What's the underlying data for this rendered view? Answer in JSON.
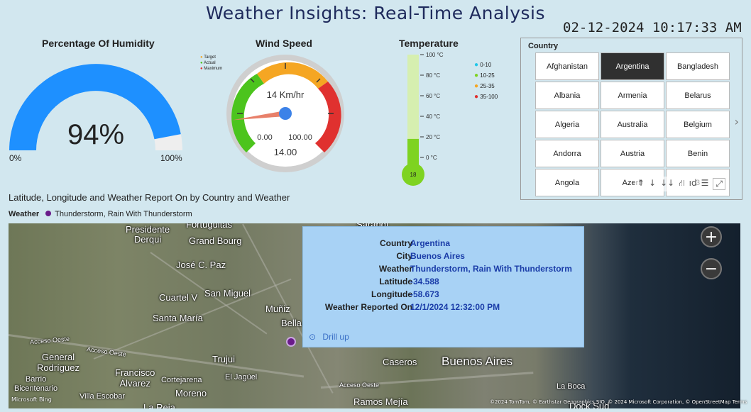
{
  "header": {
    "title": "Weather Insights: Real-Time Analysis",
    "datetime": "02-12-2024 10:17:33 AM"
  },
  "humidity": {
    "title": "Percentage Of Humidity",
    "value_label": "94%",
    "value": 94,
    "min_label": "0%",
    "max_label": "100%",
    "color": "#1e90ff"
  },
  "wind": {
    "title": "Wind Speed",
    "center_label": "14 Km/hr",
    "min_label": "0.00",
    "max_label": "100.00",
    "value_label": "14.00",
    "value": 14,
    "legend": [
      {
        "label": "Target",
        "color": "#f5a623"
      },
      {
        "label": "Actual",
        "color": "#4cc41d"
      },
      {
        "label": "Maximum",
        "color": "#e0312f"
      }
    ]
  },
  "temperature": {
    "title": "Temperature",
    "value_label": "18",
    "value": 18,
    "ticks": [
      "100 °C",
      "80 °C",
      "60 °C",
      "40 °C",
      "20 °C",
      "0 °C"
    ],
    "legend": [
      {
        "label": "0-10",
        "color": "#22c7e8"
      },
      {
        "label": "10-25",
        "color": "#7ed321"
      },
      {
        "label": "25-35",
        "color": "#f5a623"
      },
      {
        "label": "35-100",
        "color": "#e0312f"
      }
    ]
  },
  "slicer": {
    "title": "Country",
    "items": [
      "Afghanistan",
      "Argentina",
      "Bangladesh",
      "Albania",
      "Armenia",
      "Belarus",
      "Algeria",
      "Australia",
      "Belgium",
      "Andorra",
      "Austria",
      "Benin",
      "Angola",
      "Azerb",
      "3"
    ],
    "selected": "Argentina",
    "tools": [
      "↑",
      "↓",
      "↓↓",
      "⛙",
      "ıd",
      "☰",
      "⤢"
    ]
  },
  "map": {
    "title": "Latitude, Longitude and Weather Report On by Country and Weather",
    "legend_label": "Weather",
    "legend_item": "Thunderstorm, Rain With Thunderstorm",
    "labels": {
      "fortuguitas": "Fortuguitas",
      "pdte_derqui": "Presidente\nDerqui",
      "grand_bourg": "Grand Bourg",
      "jose_c_paz": "José C. Paz",
      "cuartel_v": "Cuartel V",
      "san_miguel": "San Miguel",
      "santa_maria": "Santa María",
      "muniz": "Muñiz",
      "bella": "Bella",
      "general_rodriguez": "General\nRodríguez",
      "trujui": "Trujui",
      "francisco_alvarez": "Francisco\nÁlvarez",
      "el_jaguel": "El Jagüel",
      "barrio_bicentenario": "Barrio\nBicentenario",
      "villa_escobar": "Villa Escobar",
      "cortejarena": "Cortejarena",
      "moreno": "Moreno",
      "la_reja": "La Reja",
      "caseros": "Caseros",
      "buenos_aires": "Buenos Aires",
      "la_boca": "La Boca",
      "ramos_mejia": "Ramos Mejía",
      "dock_sud": "Dock Sud",
      "sarandi": "Sarandí",
      "acceso_oeste": "Acceso Oeste"
    },
    "attribution": "©2024 TomTom, © Earthstar Geographics SIO, © 2024 Microsoft Corporation, © OpenStreetMap  Terms",
    "ms_logo": "Microsoft Bing",
    "zoom_in": "+",
    "zoom_out": "−",
    "tooltip": {
      "rows": [
        {
          "key": "Country",
          "value": "Argentina"
        },
        {
          "key": "City",
          "value": "Buenos Aires"
        },
        {
          "key": "Weather",
          "value": "Thunderstorm, Rain With Thunderstorm"
        },
        {
          "key": "Latitude",
          "value": "-34.588"
        },
        {
          "key": "Longitude",
          "value": "-58.673"
        },
        {
          "key": "Weather Reported On",
          "value": "12/1/2024 12:32:00 PM"
        }
      ],
      "drill_up": "Drill up"
    }
  }
}
